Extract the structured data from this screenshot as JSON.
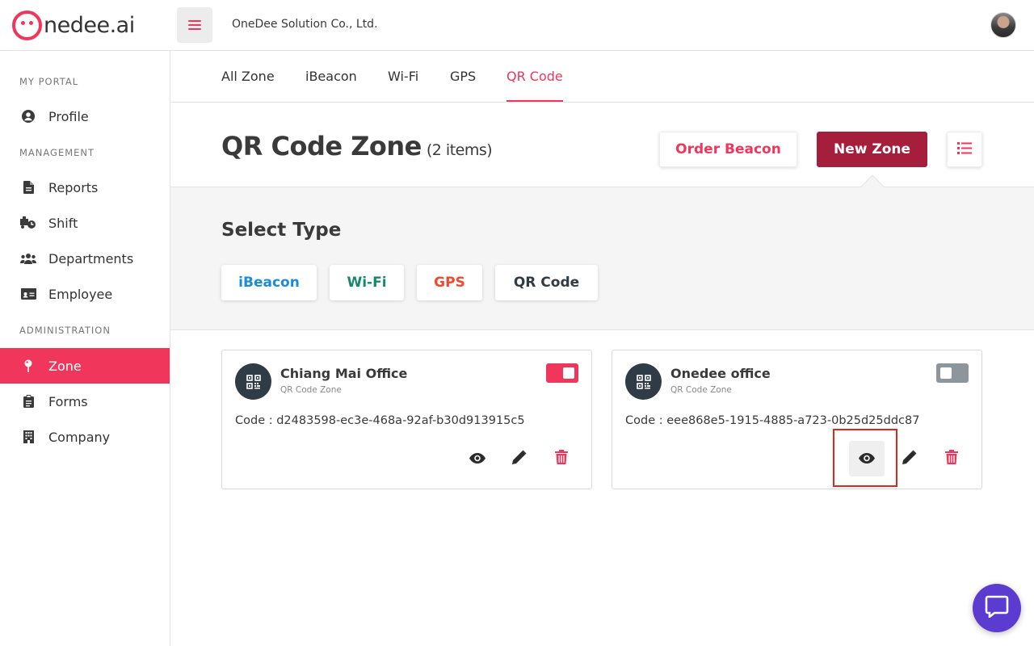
{
  "header": {
    "logo_text": "nedee.ai",
    "company": "OneDee Solution Co., Ltd."
  },
  "sidebar": {
    "sections": [
      {
        "title": "MY PORTAL"
      },
      {
        "title": "MANAGEMENT"
      },
      {
        "title": "ADMINISTRATION"
      }
    ],
    "items": [
      {
        "label": "Profile",
        "icon": "user-circle-icon"
      },
      {
        "label": "Reports",
        "icon": "document-icon"
      },
      {
        "label": "Shift",
        "icon": "truck-clock-icon"
      },
      {
        "label": "Departments",
        "icon": "users-group-icon"
      },
      {
        "label": "Employee",
        "icon": "id-card-icon"
      },
      {
        "label": "Zone",
        "icon": "map-pin-icon",
        "active": true
      },
      {
        "label": "Forms",
        "icon": "clipboard-icon"
      },
      {
        "label": "Company",
        "icon": "building-icon"
      }
    ]
  },
  "tabs": [
    {
      "label": "All Zone"
    },
    {
      "label": "iBeacon"
    },
    {
      "label": "Wi-Fi"
    },
    {
      "label": "GPS"
    },
    {
      "label": "QR Code",
      "active": true
    }
  ],
  "page": {
    "title": "QR Code Zone",
    "count": "(2 items)",
    "order_button": "Order Beacon",
    "new_button": "New Zone"
  },
  "select_type": {
    "title": "Select Type",
    "types": [
      {
        "label": "iBeacon",
        "color": "#1a8cd8"
      },
      {
        "label": "Wi-Fi",
        "color": "#148a6b"
      },
      {
        "label": "GPS",
        "color": "#f04a2e"
      },
      {
        "label": "QR Code",
        "color": "#2f3b45"
      }
    ]
  },
  "zones": [
    {
      "name": "Chiang Mai Office",
      "type": "QR Code Zone",
      "code": "Code : d2483598-ec3e-468a-92af-b30d913915c5",
      "enabled": true
    },
    {
      "name": "Onedee office",
      "type": "QR Code Zone",
      "code": "Code : eee868e5-1915-4885-a723-0b25d25ddc87",
      "enabled": false
    }
  ],
  "colors": {
    "brand": "#f0365a",
    "new_zone": "#a51e3c",
    "toggle_on": "#f0365a",
    "toggle_off": "#8e969d",
    "delete": "#f0365a",
    "chat": "#5c3bd1"
  }
}
